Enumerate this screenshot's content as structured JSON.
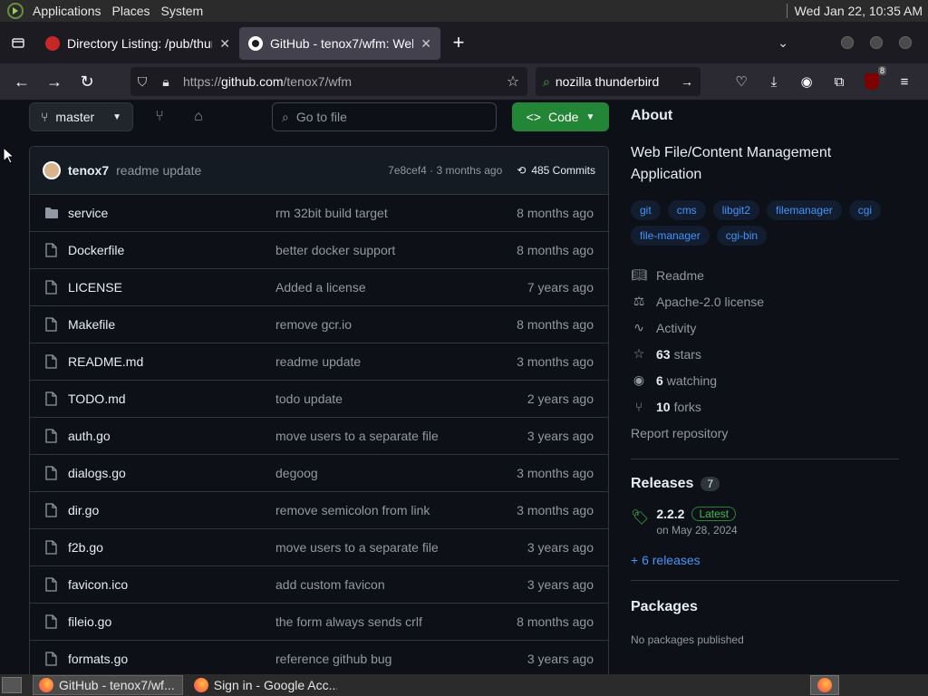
{
  "system_bar": {
    "menus": [
      "Applications",
      "Places",
      "System"
    ],
    "clock": "Wed Jan 22, 10:35 AM"
  },
  "browser": {
    "tabs": [
      {
        "title": "Directory Listing: /pub/thun",
        "active": false
      },
      {
        "title": "GitHub - tenox7/wfm: Web",
        "active": true
      }
    ],
    "url_prefix": "https://",
    "url_host": "github.com",
    "url_path": "/tenox7/wfm",
    "search_text": "nozilla thunderbird",
    "ublock_badge": "8"
  },
  "repo": {
    "branch": "master",
    "goto_placeholder": "Go to file",
    "code_button": "Code",
    "last_commit": {
      "author": "tenox7",
      "message": "readme update",
      "hash": "7e8cef4",
      "age": "3 months ago",
      "commits": "485 Commits"
    },
    "files": [
      {
        "name": "service",
        "type": "dir",
        "message": "rm 32bit build target",
        "age": "8 months ago"
      },
      {
        "name": "Dockerfile",
        "type": "file",
        "message": "better docker support",
        "age": "8 months ago"
      },
      {
        "name": "LICENSE",
        "type": "file",
        "message": "Added a license",
        "age": "7 years ago"
      },
      {
        "name": "Makefile",
        "type": "file",
        "message": "remove gcr.io",
        "age": "8 months ago"
      },
      {
        "name": "README.md",
        "type": "file",
        "message": "readme update",
        "age": "3 months ago"
      },
      {
        "name": "TODO.md",
        "type": "file",
        "message": "todo update",
        "age": "2 years ago"
      },
      {
        "name": "auth.go",
        "type": "file",
        "message": "move users to a separate file",
        "age": "3 years ago"
      },
      {
        "name": "dialogs.go",
        "type": "file",
        "message": "degoog",
        "age": "3 months ago"
      },
      {
        "name": "dir.go",
        "type": "file",
        "message": "remove semicolon from link",
        "age": "3 months ago"
      },
      {
        "name": "f2b.go",
        "type": "file",
        "message": "move users to a separate file",
        "age": "3 years ago"
      },
      {
        "name": "favicon.ico",
        "type": "file",
        "message": "add custom favicon",
        "age": "3 years ago"
      },
      {
        "name": "fileio.go",
        "type": "file",
        "message": "the form always sends crlf",
        "age": "8 months ago"
      },
      {
        "name": "formats.go",
        "type": "file",
        "message": "reference github bug",
        "age": "3 years ago"
      }
    ]
  },
  "about": {
    "heading": "About",
    "description": "Web File/Content Management Application",
    "topics": [
      "git",
      "cms",
      "libgit2",
      "filemanager",
      "cgi",
      "file-manager",
      "cgi-bin"
    ],
    "readme": "Readme",
    "license": "Apache-2.0 license",
    "activity": "Activity",
    "stars_count": "63",
    "stars_label": "stars",
    "watching_count": "6",
    "watching_label": "watching",
    "forks_count": "10",
    "forks_label": "forks",
    "report": "Report repository"
  },
  "releases": {
    "heading": "Releases",
    "count": "7",
    "latest_version": "2.2.2",
    "latest_badge": "Latest",
    "latest_date": "on May 28, 2024",
    "more": "+ 6 releases"
  },
  "packages": {
    "heading": "Packages",
    "none": "No packages published"
  },
  "taskbar": {
    "tasks": [
      "GitHub - tenox7/wf...",
      "Sign in - Google Acc..."
    ]
  }
}
